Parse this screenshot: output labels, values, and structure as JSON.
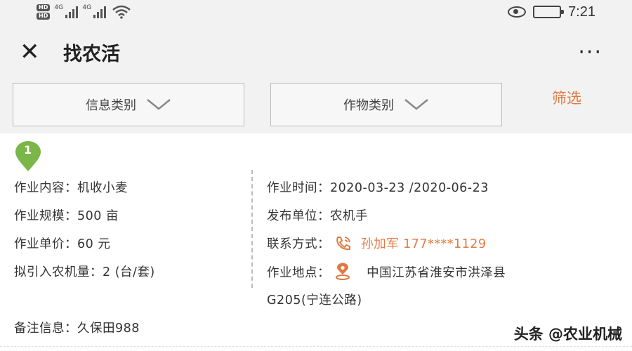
{
  "status_bar": {
    "time": "7:21",
    "hd_1": "HD",
    "hd_2": "HD",
    "signal_1": "4G",
    "signal_2": "4G"
  },
  "title_bar": {
    "title": "找农活",
    "more": "···"
  },
  "filters": {
    "info_category": "信息类别",
    "crop_category": "作物类别",
    "filter_label": "筛选"
  },
  "job": {
    "index": "1",
    "content_label": "作业内容：",
    "content_value": "机收小麦",
    "scale_label": "作业规模：",
    "scale_value": "500 亩",
    "price_label": "作业单价：",
    "price_value": "60 元",
    "machines_label": "拟引入农机量：",
    "machines_value": "2 (台/套)",
    "time_label": "作业时间：",
    "time_value": "2020-03-23 /2020-06-23",
    "publisher_label": "发布单位：",
    "publisher_value": "农机手",
    "contact_label": "联系方式：",
    "contact_value": "孙加军 177****1129",
    "location_label": "作业地点：",
    "location_line1": "中国江苏省淮安市洪泽县",
    "location_line2": "G205(宁连公路)",
    "notes_label": "备注信息：",
    "notes_value": "久保田988"
  },
  "watermark": "头条 @农业机械",
  "colors": {
    "accent": "#e07a43",
    "pin": "#7ab648",
    "card_bg": "#ffffff",
    "page_bg": "#f2f2f2"
  }
}
